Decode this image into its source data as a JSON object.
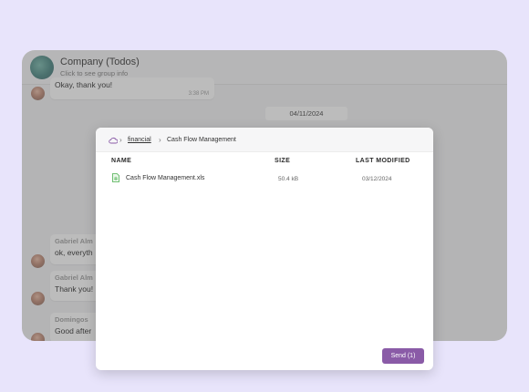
{
  "chat": {
    "header": {
      "title": "Company (Todos)",
      "subtitle": "Click to see group info"
    },
    "messages": [
      {
        "sender": "",
        "text": "Okay, thank you!",
        "time": "3:38 PM"
      },
      {
        "sender": "Gabriel Alm",
        "text": "ok, everyth",
        "time": ""
      },
      {
        "sender": "Gabriel Alm",
        "text": "Thank you!",
        "time": ""
      },
      {
        "sender": "Domingos",
        "text": "Good after",
        "time": ""
      }
    ],
    "date_separator": "04/11/2024"
  },
  "dialog": {
    "breadcrumb": {
      "root_icon": "cloud-icon",
      "items": [
        "financial",
        "Cash Flow Management"
      ]
    },
    "columns": {
      "name": "NAME",
      "size": "SIZE",
      "modified": "LAST MODIFIED"
    },
    "files": [
      {
        "icon": "spreadsheet-file-icon",
        "name": "Cash Flow Management.xls",
        "size": "50.4 kB",
        "modified": "03/12/2024"
      }
    ],
    "send_label": "Send (1)"
  },
  "colors": {
    "background": "#e8e4fb",
    "accent": "#8a5ba7",
    "file_icon": "#4caf50"
  }
}
